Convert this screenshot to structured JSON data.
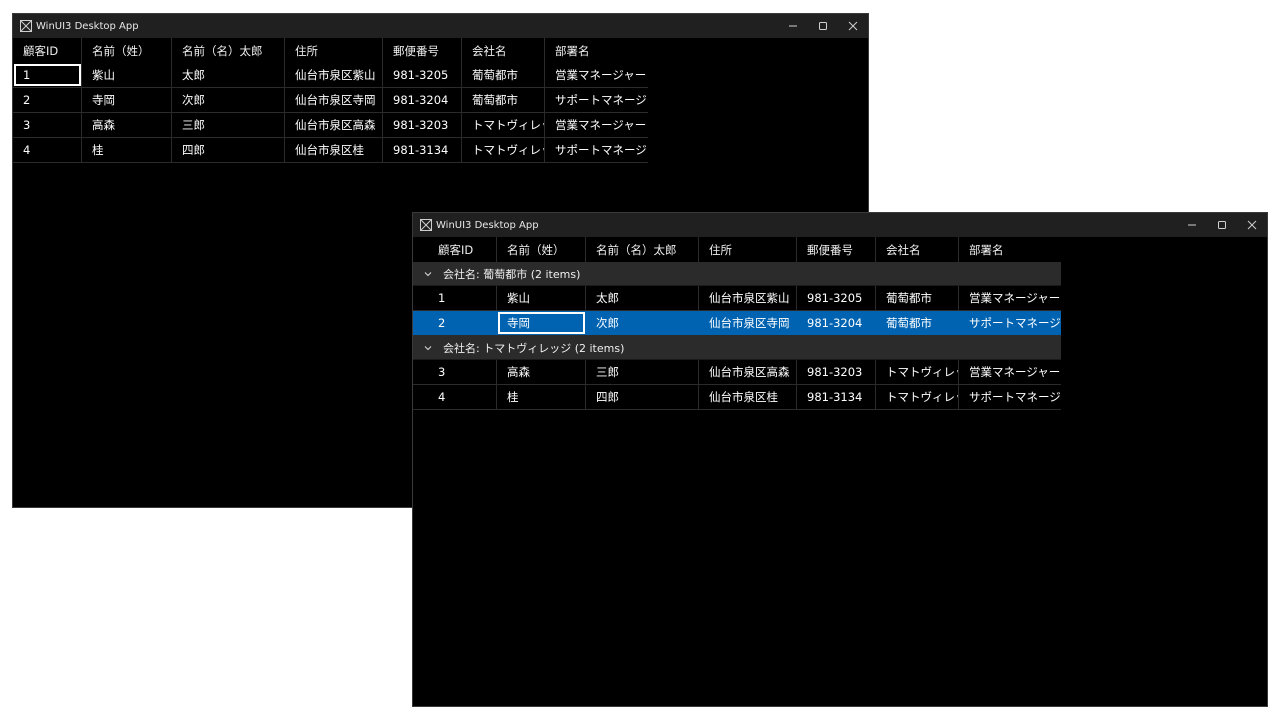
{
  "window1": {
    "title": "WinUI3 Desktop App",
    "columns": [
      "顧客ID",
      "名前（姓）",
      "名前（名）太郎",
      "住所",
      "郵便番号",
      "会社名",
      "部署名"
    ],
    "rows": [
      [
        "1",
        "紫山",
        "太郎",
        "仙台市泉区紫山",
        "981-3205",
        "葡萄都市",
        "営業マネージャー"
      ],
      [
        "2",
        "寺岡",
        "次郎",
        "仙台市泉区寺岡",
        "981-3204",
        "葡萄都市",
        "サポートマネージャー"
      ],
      [
        "3",
        "高森",
        "三郎",
        "仙台市泉区高森",
        "981-3203",
        "トマトヴィレッジ",
        "営業マネージャー"
      ],
      [
        "4",
        "桂",
        "四郎",
        "仙台市泉区桂",
        "981-3134",
        "トマトヴィレッジ",
        "サポートマネージャー"
      ]
    ]
  },
  "window2": {
    "title": "WinUI3 Desktop App",
    "columns": [
      "顧客ID",
      "名前（姓）",
      "名前（名）太郎",
      "住所",
      "郵便番号",
      "会社名",
      "部署名"
    ],
    "groups": [
      {
        "label": "会社名: 葡萄都市 (2 items)",
        "rows": [
          [
            "1",
            "紫山",
            "太郎",
            "仙台市泉区紫山",
            "981-3205",
            "葡萄都市",
            "営業マネージャー"
          ],
          [
            "2",
            "寺岡",
            "次郎",
            "仙台市泉区寺岡",
            "981-3204",
            "葡萄都市",
            "サポートマネージャー"
          ]
        ]
      },
      {
        "label": "会社名: トマトヴィレッジ (2 items)",
        "rows": [
          [
            "3",
            "高森",
            "三郎",
            "仙台市泉区高森",
            "981-3203",
            "トマトヴィレッジ",
            "営業マネージャー"
          ],
          [
            "4",
            "桂",
            "四郎",
            "仙台市泉区桂",
            "981-3134",
            "トマトヴィレッジ",
            "サポートマネージャー"
          ]
        ]
      }
    ]
  },
  "colors": {
    "selection": "#0063b1",
    "window_bg": "#000000",
    "titlebar_bg": "#202020",
    "group_bg": "#2b2b2b"
  },
  "icons": {
    "app": "window-icon",
    "minimize": "minimize-icon",
    "maximize": "maximize-icon",
    "close": "close-icon",
    "group_toggle": "chevron-down-icon"
  }
}
